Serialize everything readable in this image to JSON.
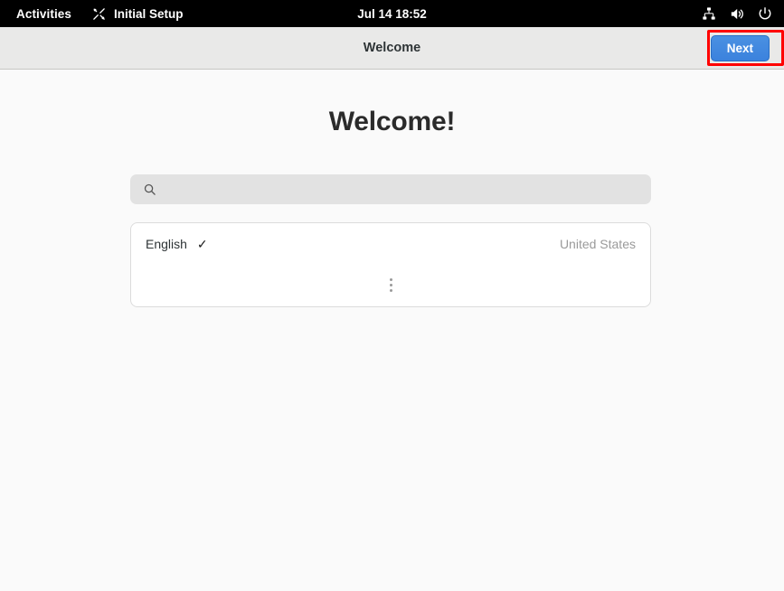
{
  "topbar": {
    "activities_label": "Activities",
    "app_name": "Initial Setup",
    "app_icon": "tools-icon",
    "clock": "Jul 14  18:52",
    "icons": [
      {
        "name": "network-wired-icon"
      },
      {
        "name": "volume-speaker-icon"
      },
      {
        "name": "power-icon"
      }
    ]
  },
  "headerbar": {
    "title": "Welcome",
    "next_label": "Next",
    "next_accent_color": "#3b82dd",
    "highlight_color": "#ff0000"
  },
  "main": {
    "heading": "Welcome!",
    "search": {
      "icon": "search-icon",
      "value": "",
      "placeholder": ""
    },
    "language_list": {
      "rows": [
        {
          "language": "English",
          "region": "United States",
          "selected_mark": "✓"
        }
      ],
      "more_indicator": "more-options-dots"
    }
  }
}
